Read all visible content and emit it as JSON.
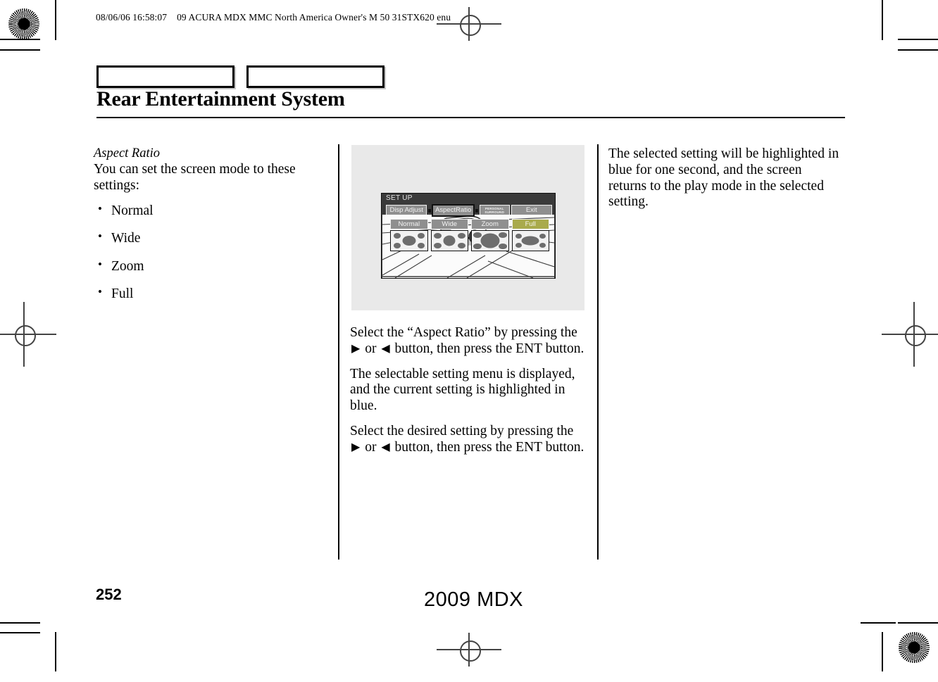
{
  "header": {
    "timestamp": "08/06/06 16:58:07",
    "document_id": "09 ACURA MDX MMC North America Owner's M 50 31STX620 enu"
  },
  "section": {
    "title": "Rear Entertainment System"
  },
  "tabs": [
    {
      "label": ""
    },
    {
      "label": ""
    }
  ],
  "left_column": {
    "subheading": "Aspect Ratio",
    "intro": "You can set the screen mode to these settings:",
    "bullets": [
      {
        "label": "Normal"
      },
      {
        "label": "Wide"
      },
      {
        "label": "Zoom"
      },
      {
        "label": "Full"
      }
    ]
  },
  "illustration": {
    "screen_title": "SET UP",
    "menu_buttons": [
      {
        "label": "Disp Adjust",
        "selected": false
      },
      {
        "label": "AspectRatio",
        "selected": true
      },
      {
        "label_line1": "PERSONAL",
        "label_line2": "SURROUND",
        "selected": false
      },
      {
        "label": "Exit",
        "selected": false
      }
    ],
    "setting_buttons": [
      {
        "label": "Normal",
        "active": false
      },
      {
        "label": "Wide",
        "active": false
      },
      {
        "label": "Zoom",
        "active": false
      },
      {
        "label": "Full",
        "active": true
      }
    ],
    "highlight_color": "#a9aa4c",
    "screen_bg_color": "#3a3a3a",
    "panel_bg_color": "#e9e9e9"
  },
  "middle_column": {
    "p1_part1": "Select the “Aspect Ratio” by pressing the ",
    "p1_arrow_right": "▶",
    "p1_part2": " or ",
    "p1_arrow_left": "◀",
    "p1_part3": " button, then press the ENT button.",
    "p2": "The selectable setting menu is displayed, and the current setting is highlighted in blue.",
    "p3_part1": "Select the desired setting by pressing the ",
    "p3_arrow_right": "▶",
    "p3_part2": " or ",
    "p3_arrow_left": "◀",
    "p3_part3": " button, then press the ENT button."
  },
  "right_column": {
    "p1": "The selected setting will be highlighted in blue for one second, and the screen returns to the play mode in the selected setting."
  },
  "footer": {
    "page_number": "252",
    "model_year": "2009  MDX"
  }
}
